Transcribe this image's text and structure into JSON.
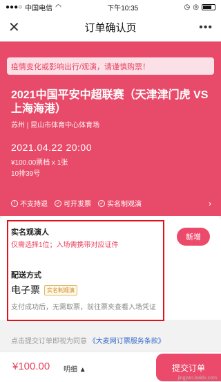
{
  "status": {
    "carrier": "中国电信",
    "time": "下午10:35"
  },
  "nav": {
    "title": "订单确认页"
  },
  "notice": {
    "text": "疫情变化或影响出行/观演，请谨慎购票！"
  },
  "event": {
    "title": "2021中国平安中超联赛（天津津门虎 VS 上海海港）",
    "venue": "苏州 | 昆山市体育中心体育场",
    "datetime": "2021.04.22 20:00",
    "price_line": "¥100.00票档 x 1张",
    "seat": "10排39号"
  },
  "features": [
    "不支持退",
    "可开发票",
    "实名制观演"
  ],
  "audience": {
    "label": "实名观演人",
    "hint": "仅需选择1位；入场需携带对应证件",
    "add_button": "新增"
  },
  "delivery": {
    "label": "配送方式",
    "method": "电子票",
    "tag": "实名制观演",
    "desc": "支付成功后，无需取票，前往票夹查看入场凭证"
  },
  "agreement": {
    "prefix": "点击提交订单即视为同意",
    "link": "《大麦网订票服务条款》"
  },
  "footer": {
    "total": "¥100.00",
    "detail": "明细",
    "submit": "提交订单"
  },
  "watermark": "jingyan.baidu.com"
}
